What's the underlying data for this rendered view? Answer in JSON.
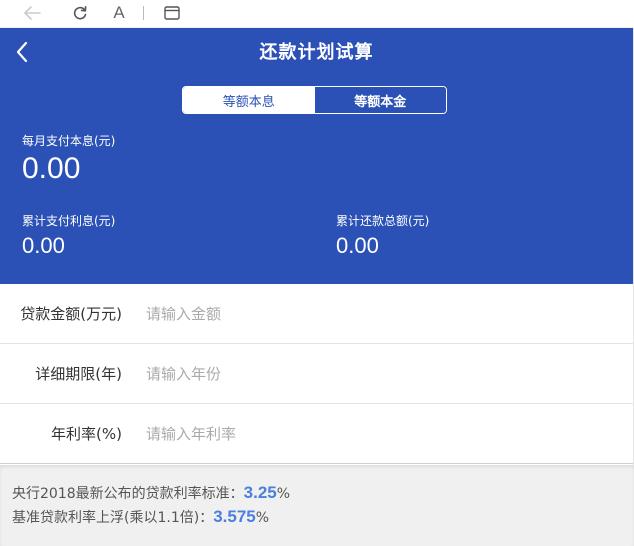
{
  "browser": {
    "font_glyph": "A",
    "icons": [
      "back-arrow-icon",
      "reload-icon",
      "font-size-icon",
      "window-icon"
    ]
  },
  "header": {
    "title": "还款计划试算",
    "back_icon": "chevron-left-icon",
    "tabs": [
      {
        "label": "等额本息",
        "active": false
      },
      {
        "label": "等额本金",
        "active": true
      }
    ]
  },
  "summary": {
    "monthly_label": "每月支付本息(元)",
    "monthly_value": "0.00",
    "interest_label": "累计支付利息(元)",
    "interest_value": "0.00",
    "total_label": "累计还款总额(元)",
    "total_value": "0.00"
  },
  "form": {
    "fields": [
      {
        "label": "贷款金额(万元)",
        "placeholder": "请输入金额",
        "value": ""
      },
      {
        "label": "详细期限(年)",
        "placeholder": "请输入年份",
        "value": ""
      },
      {
        "label": "年利率(%)",
        "placeholder": "请输入年利率",
        "value": ""
      }
    ]
  },
  "notice": {
    "line1_text": "央行2018最新公布的贷款利率标准：",
    "line1_rate": "3.25",
    "line1_unit": "%",
    "line2_text": "基准贷款利率上浮(乘以1.1倍)：",
    "line2_rate": "3.575",
    "line2_unit": "%"
  },
  "colors": {
    "primary": "#2b51b7",
    "rate_highlight": "#4a7fe0",
    "notice_bg": "#f0f0f0"
  }
}
